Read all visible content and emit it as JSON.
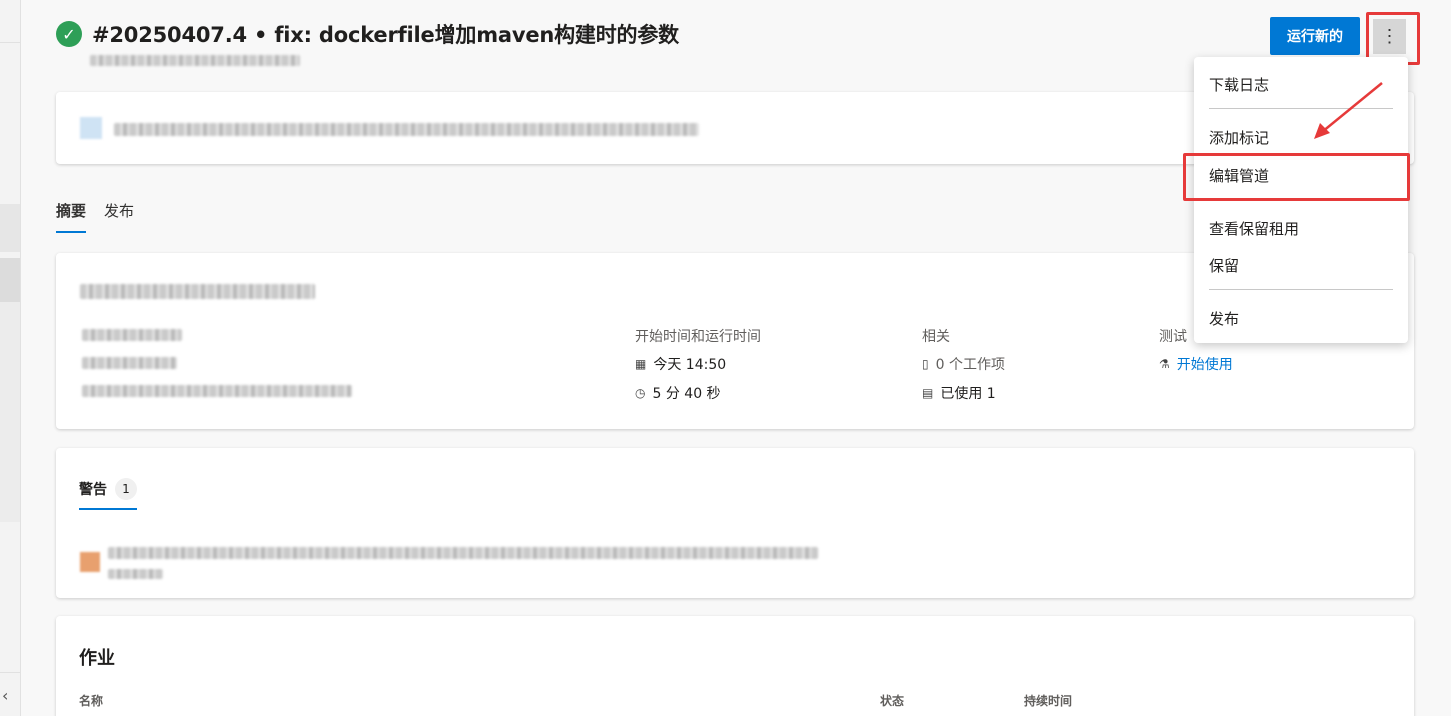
{
  "run": {
    "title": "#20250407.4 • fix: dockerfile增加maven构建时的参数",
    "status_icon": "check-icon"
  },
  "header": {
    "run_new_label": "运行新的",
    "more_label": "⋮"
  },
  "tabs": [
    {
      "label": "摘要",
      "active": true
    },
    {
      "label": "发布",
      "active": false
    }
  ],
  "summary": {
    "start_header": "开始时间和运行时间",
    "start_time": "今天 14:50",
    "duration": "5 分 40 秒",
    "related_header": "相关",
    "work_items": "0 个工作项",
    "used": "已使用 1",
    "tests_header": "测试",
    "tests_link": "开始使用"
  },
  "warnings": {
    "tab_label": "警告",
    "count": "1"
  },
  "jobs": {
    "title": "作业",
    "columns": [
      "名称",
      "状态",
      "持续时间"
    ]
  },
  "menu": {
    "items": [
      "下载日志",
      "添加标记",
      "编辑管道",
      "查看保留租用",
      "保留",
      "发布"
    ]
  },
  "colors": {
    "accent": "#0078d4",
    "success": "#2e9f57",
    "highlight": "#e63a3a"
  }
}
